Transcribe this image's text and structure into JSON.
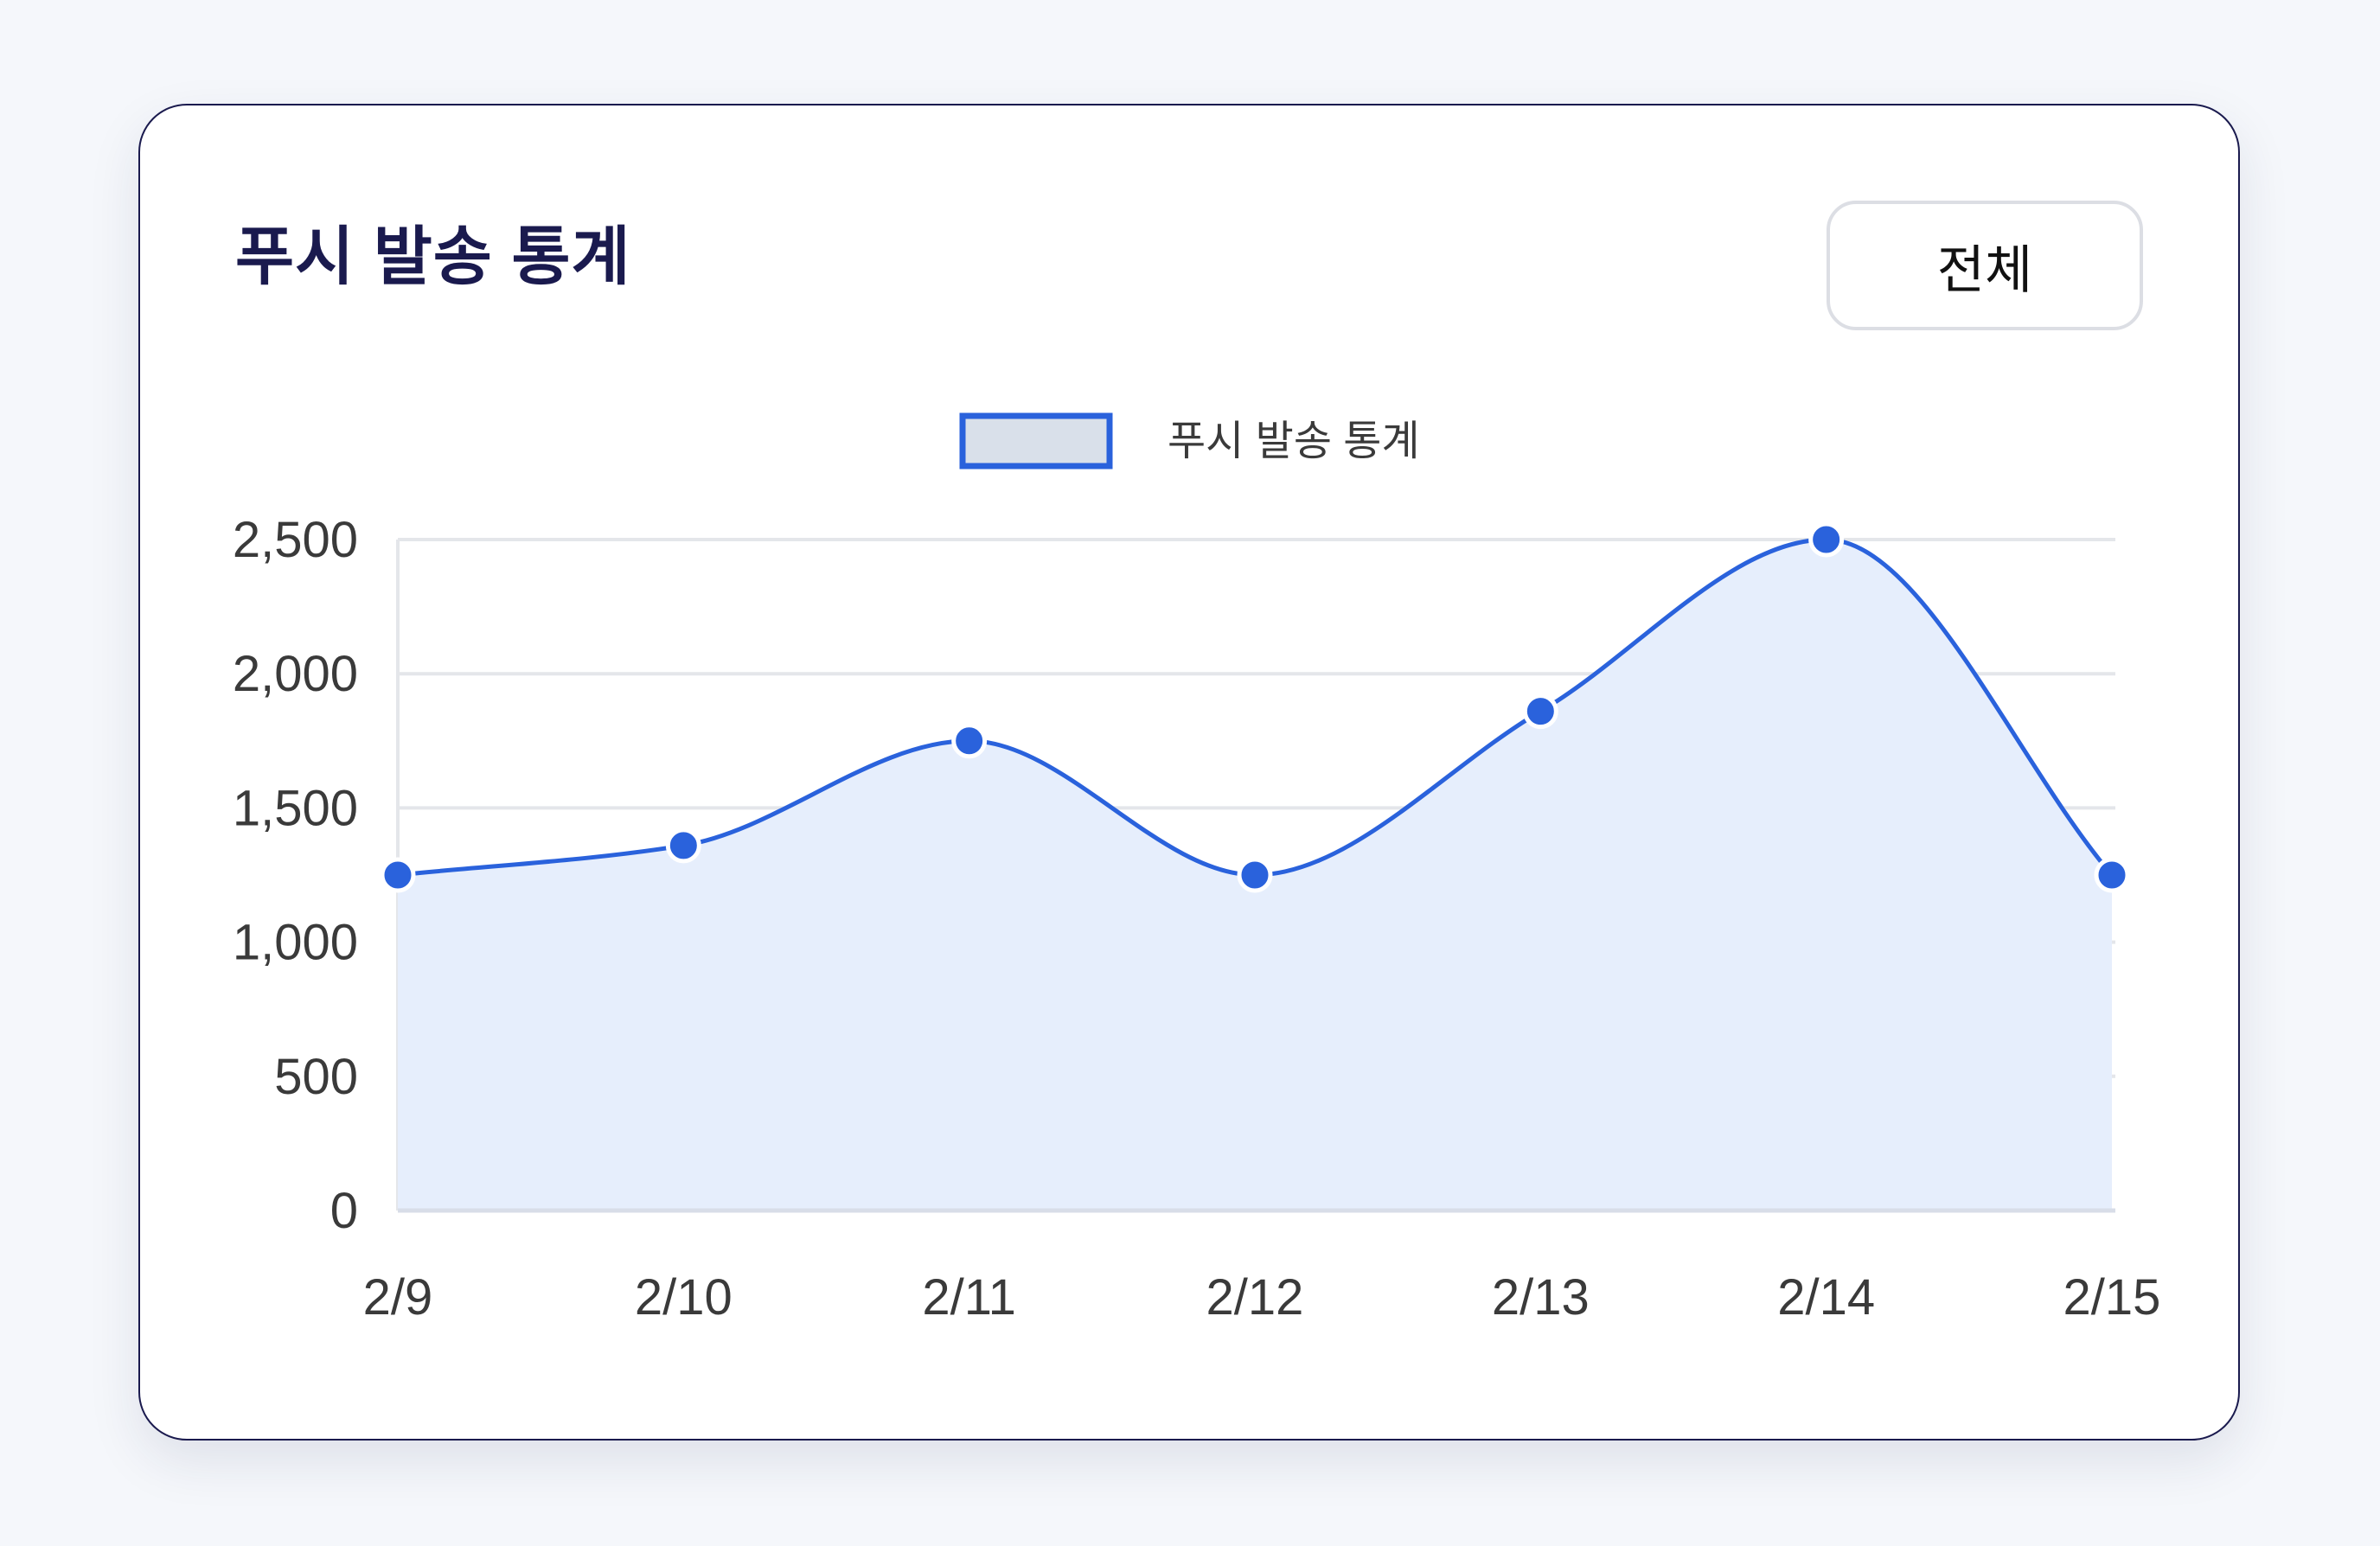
{
  "card": {
    "title": "푸시 발송 통계",
    "filter_button_label": "전체"
  },
  "chart_data": {
    "type": "area",
    "x": [
      "2/9",
      "2/10",
      "2/11",
      "2/12",
      "2/13",
      "2/14",
      "2/15"
    ],
    "series": [
      {
        "name": "푸시 발송 통계",
        "values": [
          1250,
          1360,
          1750,
          1250,
          1860,
          2500,
          1250
        ]
      }
    ],
    "yticks": [
      "0",
      "500",
      "1,000",
      "1,500",
      "2,000",
      "2,500"
    ],
    "ytick_values": [
      0,
      500,
      1000,
      1500,
      2000,
      2500
    ],
    "ylim": [
      0,
      2500
    ],
    "grid": true,
    "legend_position": "top-center",
    "smooth": true,
    "colors": {
      "line": "#2a62dc",
      "fill": "#e6eefc",
      "point": "#2a62dc",
      "point_border": "#ffffff",
      "legend_swatch_fill": "#d9e0ea",
      "legend_swatch_border": "#2a62dc",
      "grid": "#e4e6ea",
      "tick_text": "#3a3a3a",
      "legend_text": "#3a3a3a"
    }
  }
}
